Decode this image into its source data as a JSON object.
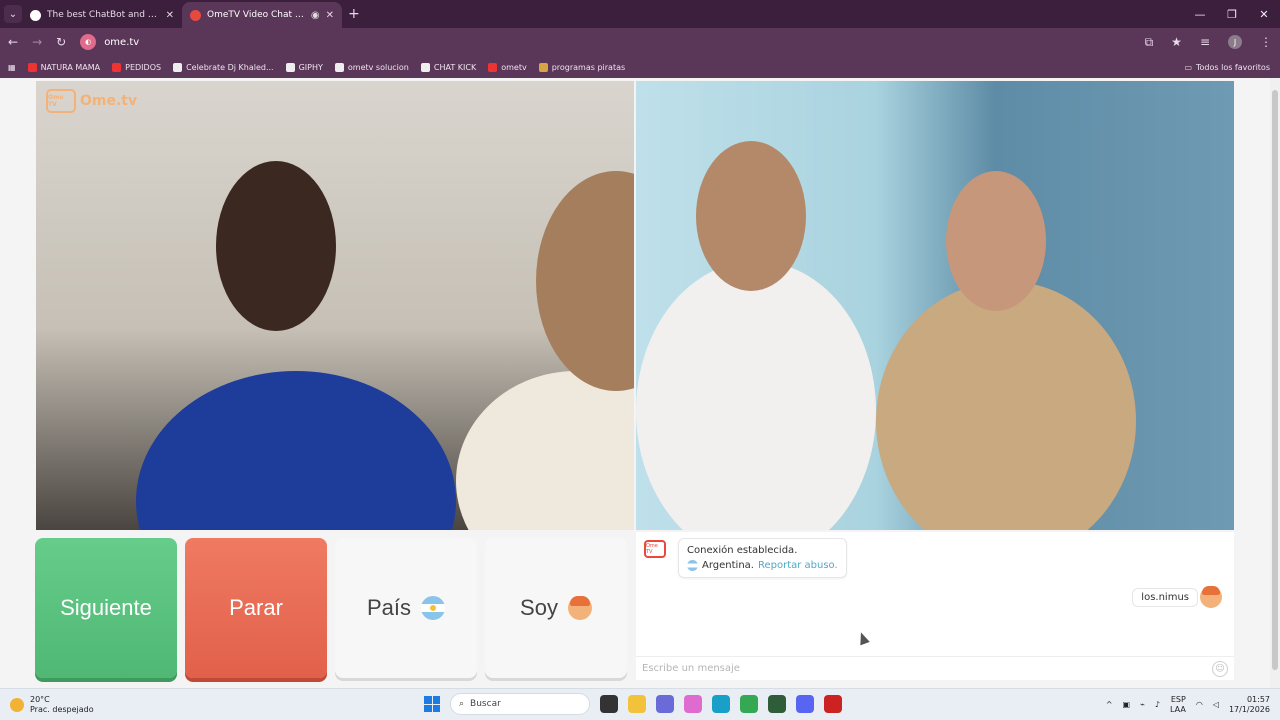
{
  "tabs": [
    {
      "title": "The best ChatBot and Widgets",
      "active": false
    },
    {
      "title": "OmeTV Video Chat — Ome",
      "active": true
    }
  ],
  "address": {
    "url": "ome.tv"
  },
  "bookmarks": [
    "NATURA MAMA",
    "PEDIDOS",
    "Celebrate Dj Khaled...",
    "GIPHY",
    "ometv solucion",
    "CHAT KICK",
    "ometv",
    "programas piratas"
  ],
  "bookmarks_folder": "Todos los favoritos",
  "logo": {
    "text": "Ome.tv",
    "badge": "Ome TV"
  },
  "controls": {
    "next_label": "Siguiente",
    "stop_label": "Parar",
    "country_label": "País",
    "gender_label": "Soy"
  },
  "chat": {
    "logo_badge": "Ome TV",
    "system_line1": "Conexión establecida.",
    "system_country": "Argentina.",
    "report_link": "Reportar abuso.",
    "user_message": "los.nimus",
    "input_placeholder": "Escribe un mensaje"
  },
  "taskbar": {
    "weather_temp": "20°C",
    "weather_desc": "Prac. despejado",
    "search_placeholder": "Buscar",
    "lang_top": "ESP",
    "lang_bottom": "LAA",
    "time": "01:57",
    "date": "17/1/2026"
  },
  "colors": {
    "next": "#4fb874",
    "stop": "#e2604a",
    "brand": "#f3b27a",
    "link": "#4fa8c8"
  }
}
